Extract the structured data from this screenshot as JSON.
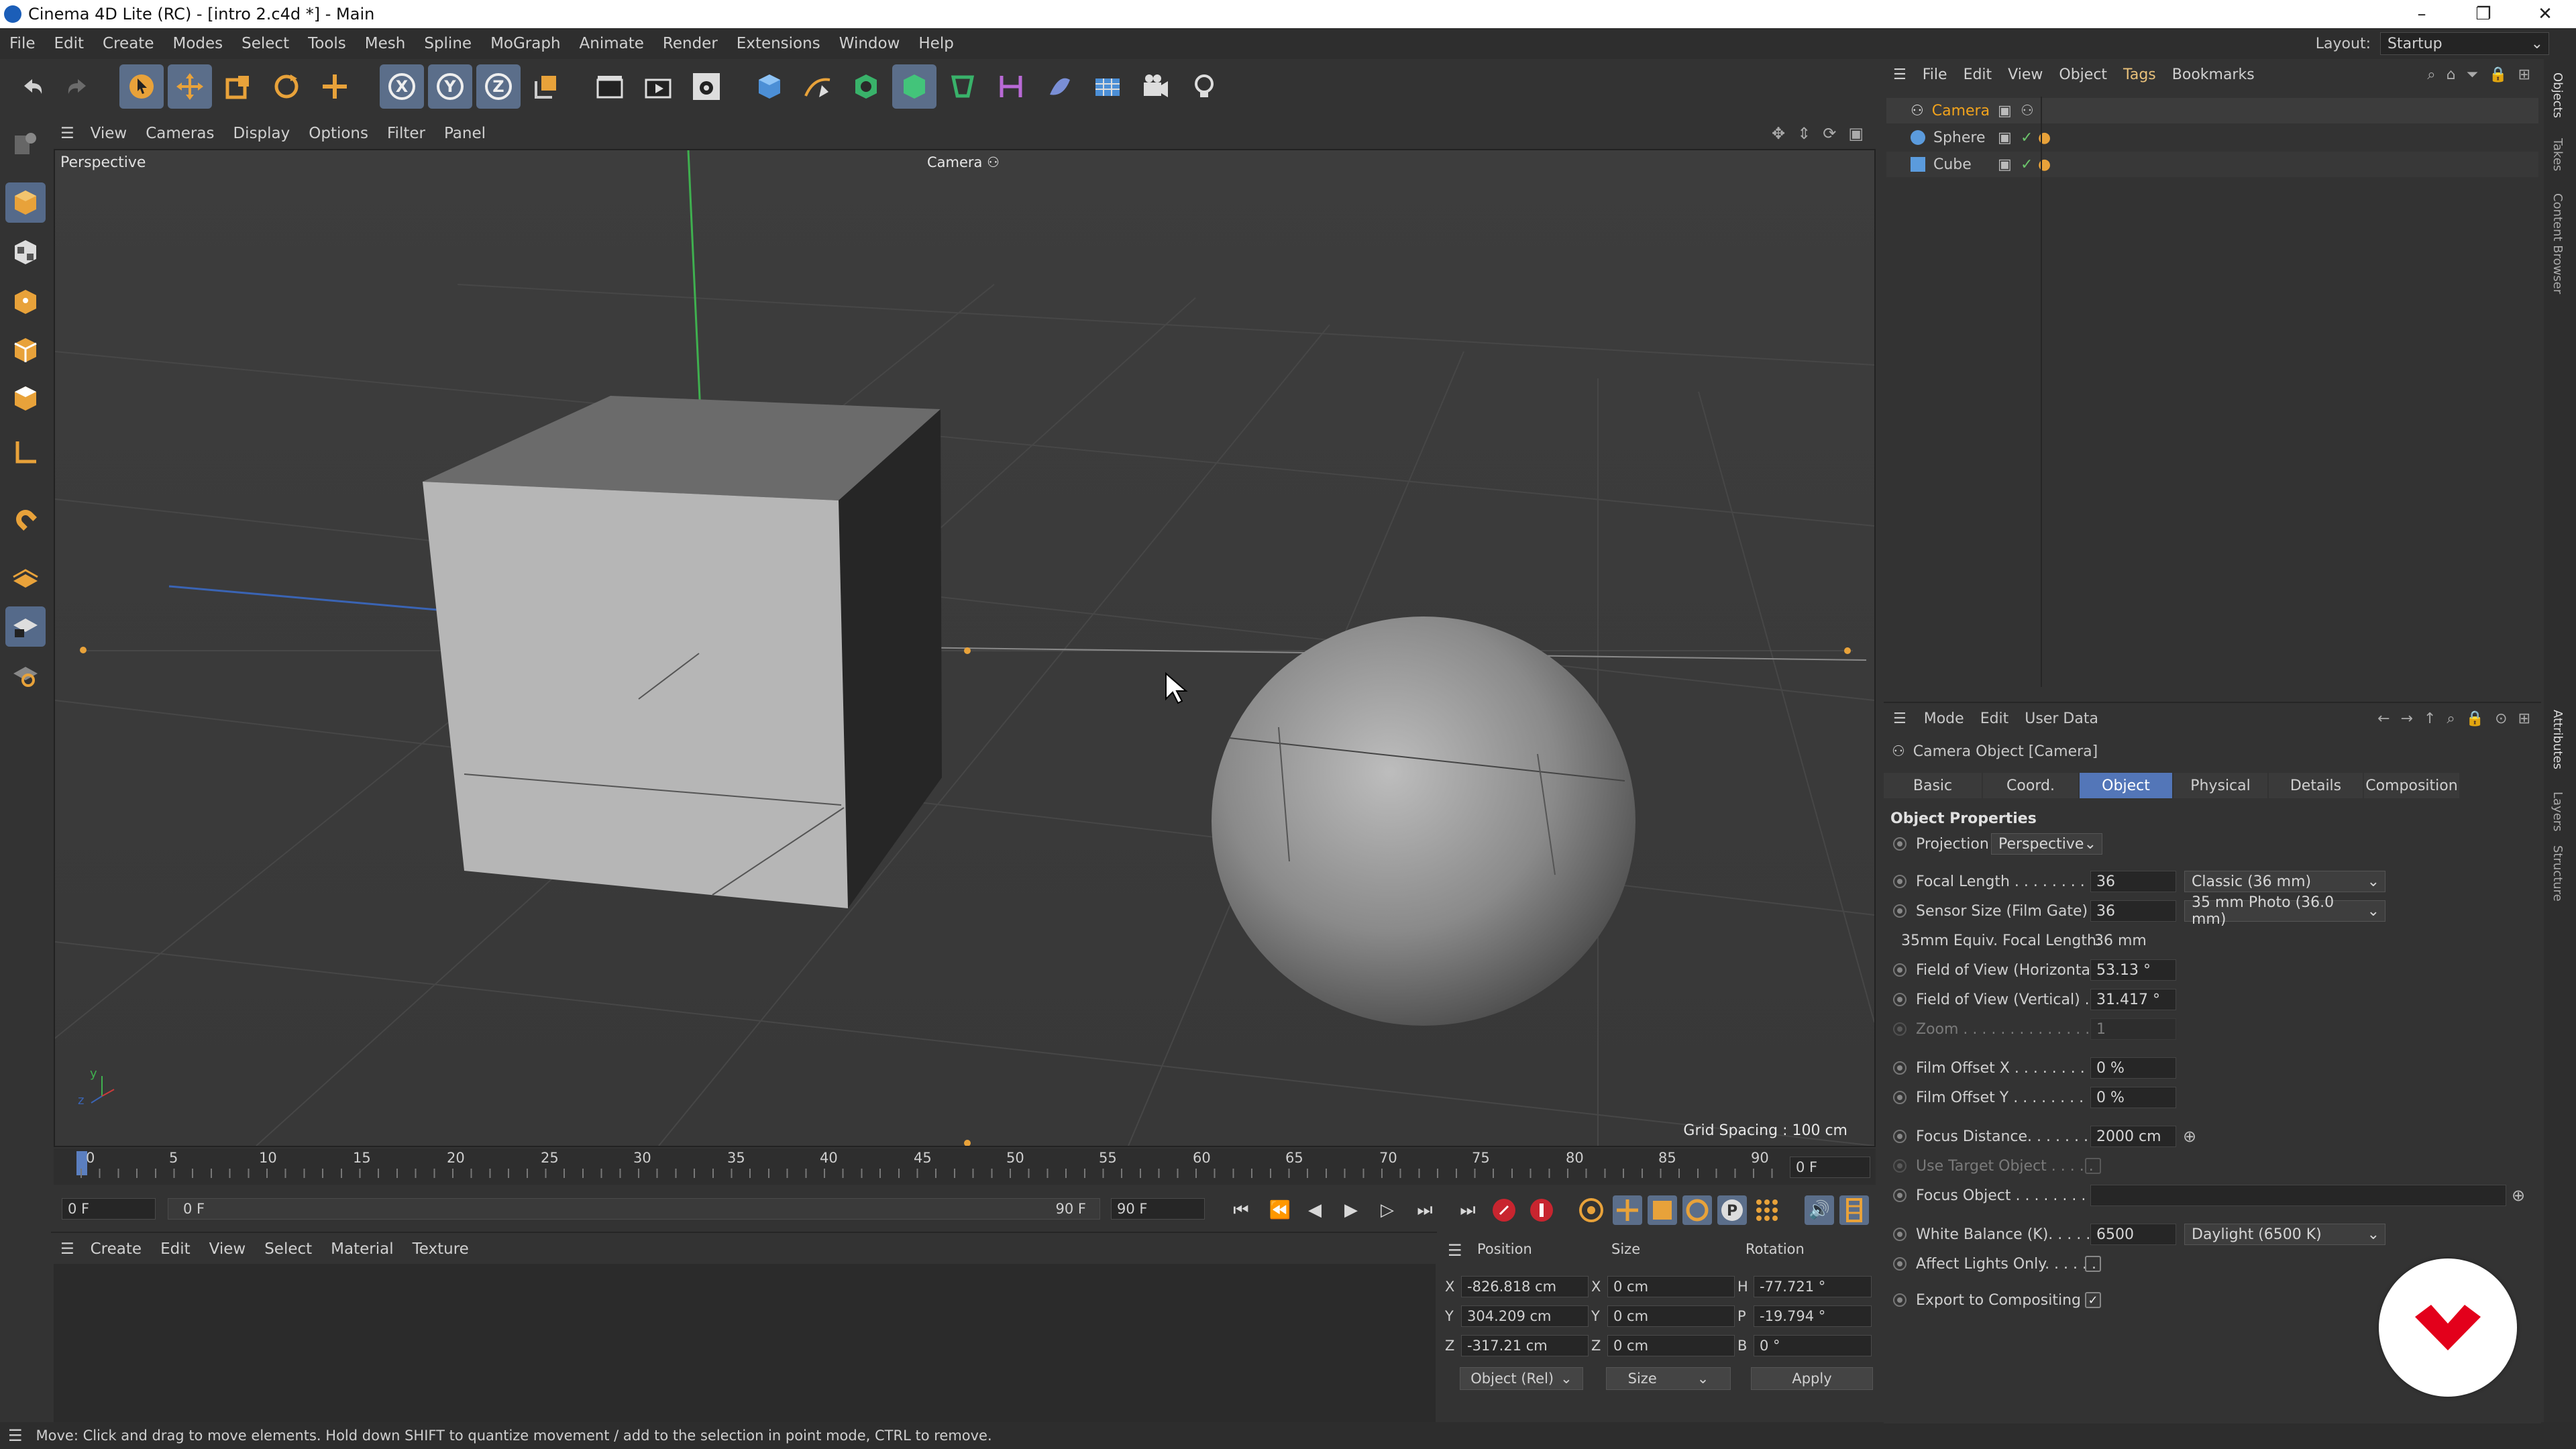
{
  "window": {
    "title": "Cinema 4D Lite (RC) - [intro 2.c4d *] - Main",
    "min": "–",
    "max": "❐",
    "close": "✕"
  },
  "menubar": {
    "items": [
      "File",
      "Edit",
      "Create",
      "Modes",
      "Select",
      "Tools",
      "Mesh",
      "Spline",
      "MoGraph",
      "Animate",
      "Render",
      "Extensions",
      "Window",
      "Help"
    ],
    "layout_label": "Layout:",
    "layout_value": "Startup"
  },
  "viewport": {
    "menu": [
      "View",
      "Cameras",
      "Display",
      "Options",
      "Filter",
      "Panel"
    ],
    "label": "Perspective",
    "camera_label": "Camera",
    "grid_spacing": "Grid Spacing : 100 cm",
    "axis_y": "y",
    "axis_z": "z"
  },
  "timeline": {
    "ticks": [
      "0",
      "5",
      "10",
      "15",
      "20",
      "25",
      "30",
      "35",
      "40",
      "45",
      "50",
      "55",
      "60",
      "65",
      "70",
      "75",
      "80",
      "85",
      "90"
    ],
    "current_frame": "0 F",
    "start_field": "0 F",
    "range_start": "0 F",
    "range_end": "90 F",
    "end_field": "90 F"
  },
  "materials": {
    "menu": [
      "Create",
      "Edit",
      "View",
      "Select",
      "Material",
      "Texture"
    ]
  },
  "coord": {
    "headers": {
      "position": "Position",
      "size": "Size",
      "rotation": "Rotation"
    },
    "rows": [
      {
        "axis": "X",
        "pos": "-826.818 cm",
        "saxis": "X",
        "size": "0 cm",
        "raxis": "H",
        "rot": "-77.721 °"
      },
      {
        "axis": "Y",
        "pos": "304.209 cm",
        "saxis": "Y",
        "size": "0 cm",
        "raxis": "P",
        "rot": "-19.794 °"
      },
      {
        "axis": "Z",
        "pos": "-317.21 cm",
        "saxis": "Z",
        "size": "0 cm",
        "raxis": "B",
        "rot": "0 °"
      }
    ],
    "mode": "Object (Rel)",
    "size_mode": "Size",
    "apply": "Apply"
  },
  "status": "Move: Click and drag to move elements. Hold down SHIFT to quantize movement / add to the selection in point mode, CTRL to remove.",
  "objects": {
    "menu": [
      "File",
      "Edit",
      "View",
      "Object",
      "Tags",
      "Bookmarks"
    ],
    "items": [
      {
        "name": "Camera",
        "color": "#f2a31c"
      },
      {
        "name": "Sphere",
        "color": "#d0d0d0"
      },
      {
        "name": "Cube",
        "color": "#d0d0d0"
      }
    ]
  },
  "right_tabs": {
    "objects": "Objects",
    "takes": "Takes",
    "content": "Content Browser",
    "attributes": "Attributes",
    "layers": "Layers",
    "structure": "Structure"
  },
  "attributes": {
    "menu": [
      "Mode",
      "Edit",
      "User Data"
    ],
    "title": "Camera Object [Camera]",
    "tabs": [
      "Basic",
      "Coord.",
      "Object",
      "Physical",
      "Details",
      "Composition"
    ],
    "section": "Object Properties",
    "projection_label": "Projection",
    "projection_value": "Perspective",
    "focal_length_label": "Focal Length . . . . . . . .",
    "focal_length": "36",
    "focal_preset": "Classic (36 mm)",
    "sensor_label": "Sensor Size (Film Gate) .",
    "sensor": "36",
    "sensor_preset": "35 mm Photo (36.0 mm)",
    "equiv_label": "35mm Equiv. Focal Length:",
    "equiv_value": "36 mm",
    "fovh_label": "Field of View (Horizontal)",
    "fovh": "53.13 °",
    "fovv_label": "Field of View (Vertical) . .",
    "fovv": "31.417 °",
    "zoom_label": "Zoom . . . . . . . . . . . . . .",
    "zoom": "1",
    "offx_label": "Film Offset X . . . . . . . .",
    "offx": "0 %",
    "offy_label": "Film Offset Y . . . . . . . .",
    "offy": "0 %",
    "focus_label": "Focus Distance. . . . . . . .",
    "focus": "2000 cm",
    "target_label": "Use Target Object . . . . .",
    "focus_obj_label": "Focus Object . . . . . . . . .",
    "wb_label": "White Balance (K). . . . . .",
    "wb": "6500",
    "wb_preset": "Daylight (6500 K)",
    "affect_label": "Affect Lights Only. . . . . .",
    "export_label": "Export to Compositing . ."
  },
  "colors": {
    "accent": "#5376b8",
    "camera": "#f2a31c",
    "logo": "#e3001b"
  }
}
